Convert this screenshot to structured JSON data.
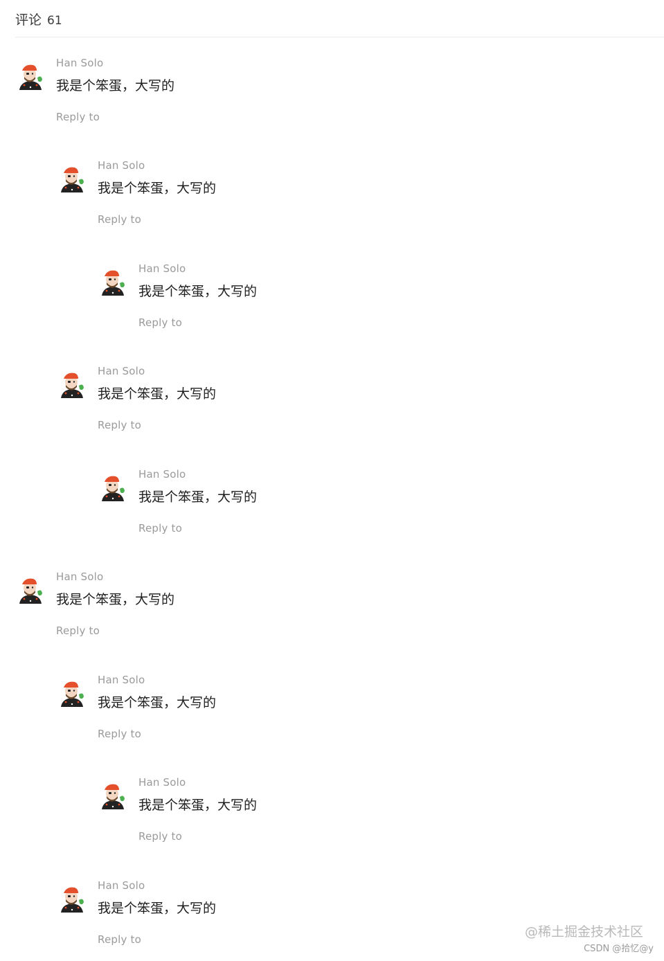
{
  "header": {
    "title": "评论",
    "count": "61"
  },
  "comments": [
    {
      "author": "Han Solo",
      "content": "我是个笨蛋，大写的",
      "reply_label": "Reply to",
      "level": 0
    },
    {
      "author": "Han Solo",
      "content": "我是个笨蛋，大写的",
      "reply_label": "Reply to",
      "level": 1
    },
    {
      "author": "Han Solo",
      "content": "我是个笨蛋，大写的",
      "reply_label": "Reply to",
      "level": 2
    },
    {
      "author": "Han Solo",
      "content": "我是个笨蛋，大写的",
      "reply_label": "Reply to",
      "level": 1
    },
    {
      "author": "Han Solo",
      "content": "我是个笨蛋，大写的",
      "reply_label": "Reply to",
      "level": 2
    },
    {
      "author": "Han Solo",
      "content": "我是个笨蛋，大写的",
      "reply_label": "Reply to",
      "level": 0
    },
    {
      "author": "Han Solo",
      "content": "我是个笨蛋，大写的",
      "reply_label": "Reply to",
      "level": 1
    },
    {
      "author": "Han Solo",
      "content": "我是个笨蛋，大写的",
      "reply_label": "Reply to",
      "level": 2
    },
    {
      "author": "Han Solo",
      "content": "我是个笨蛋，大写的",
      "reply_label": "Reply to",
      "level": 1
    }
  ],
  "watermark": "@稀土掘金技术社区",
  "credit": "CSDN @拾忆@y",
  "colors": {
    "author": "#9a9a9a",
    "content": "#1f1f1f",
    "divider": "#ebebeb",
    "avatar_hat": "#e4502b",
    "avatar_accent": "#4caf50"
  },
  "icons": {
    "avatar": "pirate-avatar-icon"
  }
}
